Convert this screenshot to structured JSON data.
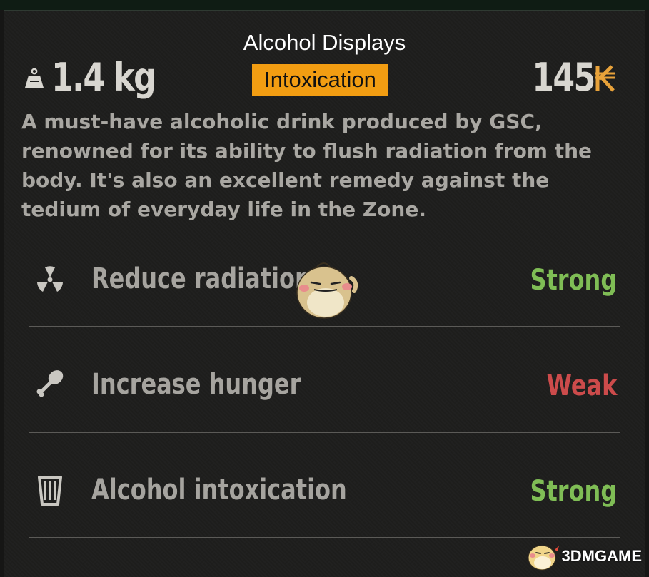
{
  "overlay": {
    "title": "Alcohol Displays",
    "badge": "Intoxication"
  },
  "item": {
    "weight": "1.4 kg",
    "price": "145",
    "description": "A must-have alcoholic drink produced by GSC, renowned for its ability to flush radiation from the body. It's also an excellent remedy against the tedium of everyday life in the Zone."
  },
  "stats": [
    {
      "icon": "radiation-icon",
      "label": "Reduce radiation",
      "value": "Strong",
      "value_color": "#7fbd55"
    },
    {
      "icon": "hunger-drumstick-icon",
      "label": "Increase hunger",
      "value": "Weak",
      "value_color": "#cc4b4b"
    },
    {
      "icon": "glass-icon",
      "label": "Alcohol intoxication",
      "value": "Strong",
      "value_color": "#7fbd55"
    }
  ],
  "watermark": {
    "text": "3DMGAME"
  },
  "colors": {
    "background": "#1e1e1d",
    "badge": "#f29d12",
    "strong": "#7fbd55",
    "weak": "#cc4b4b",
    "coupon": "#e8a23a"
  }
}
